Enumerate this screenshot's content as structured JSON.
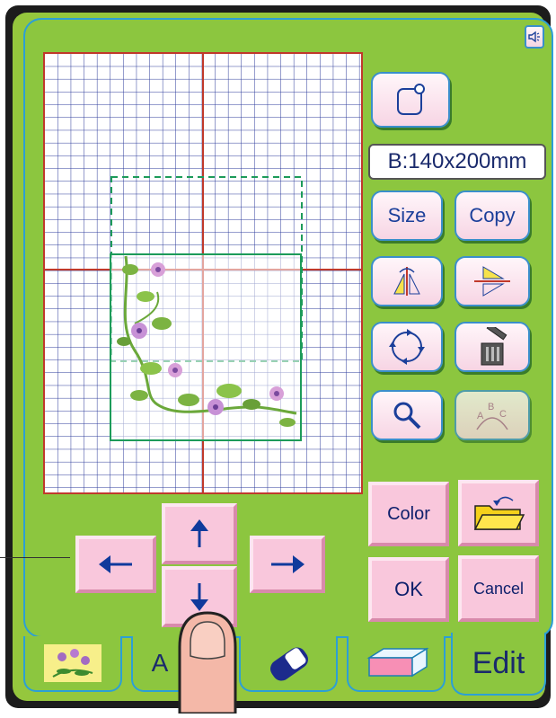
{
  "hoop_size": "B:140x200mm",
  "buttons": {
    "size": "Size",
    "copy": "Copy",
    "color": "Color",
    "ok": "OK",
    "cancel": "Cancel"
  },
  "tabs": {
    "letters_prefix": "A",
    "edit": "Edit"
  },
  "icons": {
    "sound": "speaker-icon",
    "hoop": "hoop-select-icon",
    "mirror": "mirror-icon",
    "flip": "flip-icon",
    "rotate": "rotate-icon",
    "delete": "trash-icon",
    "magnify": "magnifier-icon",
    "arc_text": "arc-text-icon",
    "memory": "folder-save-icon",
    "arrows": [
      "arrow-up-icon",
      "arrow-down-icon",
      "arrow-left-icon",
      "arrow-right-icon"
    ]
  },
  "colors": {
    "panel": "#8cc63f",
    "button": "#f9c7dc",
    "accent": "#2c9fd6",
    "grid_line": "#1f2f8f",
    "center_line": "#c0392b",
    "hoop_line": "#1d9b5a"
  }
}
